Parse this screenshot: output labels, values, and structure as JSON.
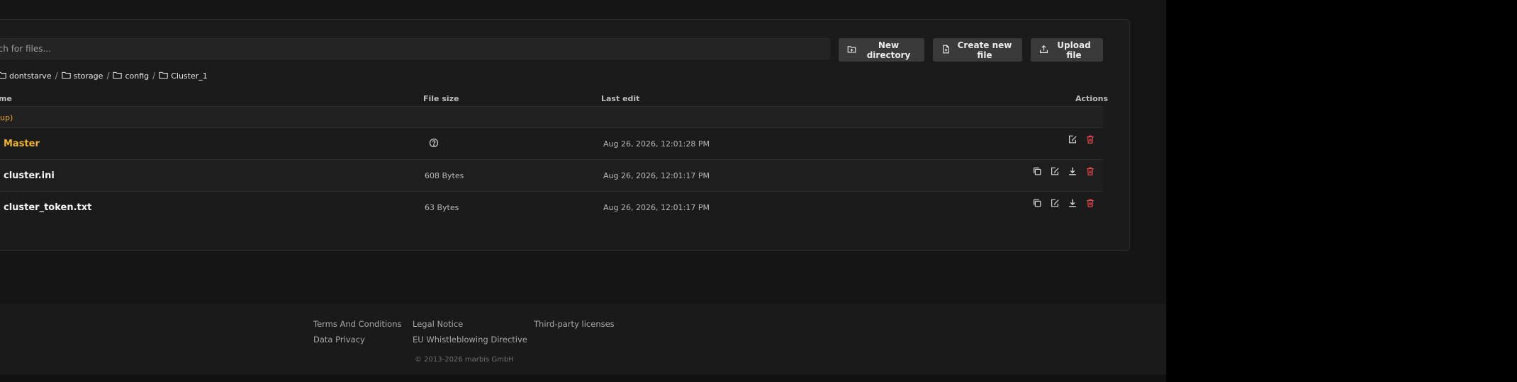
{
  "search": {
    "placeholder": "rch for files..."
  },
  "toolbar": {
    "new_directory": "New directory",
    "create_new_file": "Create new file",
    "upload_file": "Upload file"
  },
  "breadcrumb": [
    {
      "label": "dontstarve"
    },
    {
      "label": "storage"
    },
    {
      "label": "config"
    },
    {
      "label": "Cluster_1"
    }
  ],
  "breadcrumb_separator": "/",
  "table": {
    "headers": {
      "name": "me",
      "size": "File size",
      "last_edit": "Last edit",
      "actions": "Actions"
    },
    "parent_row": "up)",
    "rows": [
      {
        "name": "Master",
        "type": "directory",
        "size": "",
        "last_edit": "Aug 26, 2026, 12:01:28 PM",
        "size_icon": "help-circle-icon"
      },
      {
        "name": "cluster.ini",
        "type": "file",
        "size": "608 Bytes",
        "last_edit": "Aug 26, 2026, 12:01:17 PM"
      },
      {
        "name": "cluster_token.txt",
        "type": "file",
        "size": "63 Bytes",
        "last_edit": "Aug 26, 2026, 12:01:17 PM"
      }
    ]
  },
  "footer": {
    "links": {
      "terms": "Terms And Conditions",
      "privacy": "Data Privacy",
      "legal": "Legal Notice",
      "whistleblowing": "EU Whistleblowing Directive",
      "third_party": "Third-party licenses"
    },
    "copyright": "© 2013-2026 marbis GmbH"
  },
  "colors": {
    "page_background": "#141414",
    "card_background": "#1b1b1b",
    "button_background": "#3a3a3a",
    "directory_accent": "#f0b429",
    "delete_red": "#e5484d"
  }
}
